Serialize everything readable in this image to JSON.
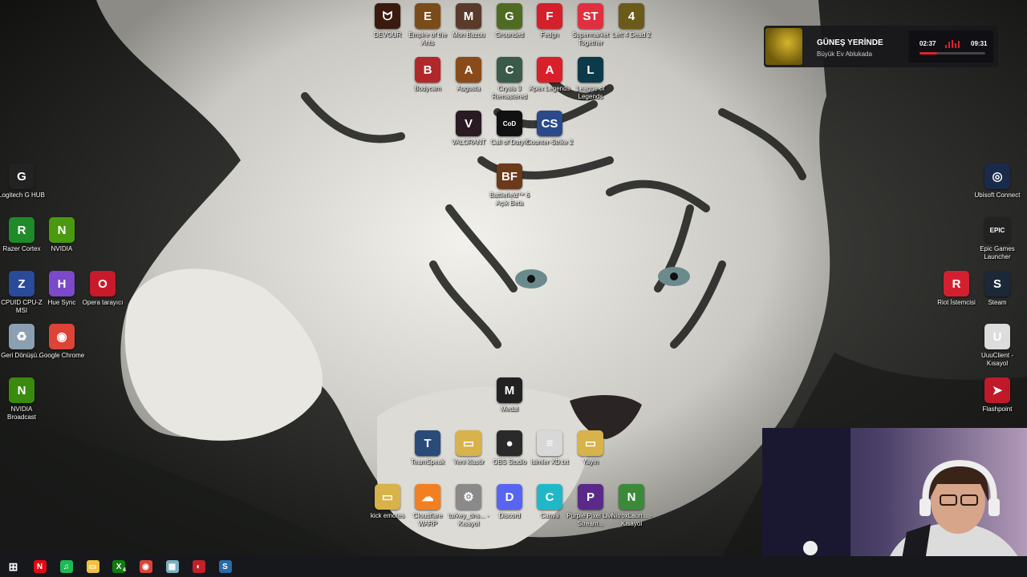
{
  "desktop_icons": [
    {
      "id": "devour",
      "label": "DEVOUR",
      "glyph": "ᗢ",
      "color": "#3a1a0e"
    },
    {
      "id": "empire-of-the-ants",
      "label": "Empire of the Ants",
      "glyph": "E",
      "color": "#7a4c1a"
    },
    {
      "id": "mon-bazou",
      "label": "Mon Bazou",
      "glyph": "M",
      "color": "#5a3a2a"
    },
    {
      "id": "grounded",
      "label": "Grounded",
      "glyph": "G",
      "color": "#4f6b21"
    },
    {
      "id": "fedgn",
      "label": "Fedgn",
      "glyph": "F",
      "color": "#d3202a"
    },
    {
      "id": "supermarket-together",
      "label": "Supermarket Together",
      "glyph": "ST",
      "color": "#e03040"
    },
    {
      "id": "left-4-dead-2",
      "label": "Left 4 Dead 2",
      "glyph": "4",
      "color": "#6b5a1a"
    },
    {
      "id": "bodycam",
      "label": "Bodycam",
      "glyph": "B",
      "color": "#b0282a"
    },
    {
      "id": "augusta",
      "label": "Augusta",
      "glyph": "A",
      "color": "#8a4a1a"
    },
    {
      "id": "crysis-3",
      "label": "Crysis 3 Remastered",
      "glyph": "C",
      "color": "#3a5a4a"
    },
    {
      "id": "apex-legends",
      "label": "Apex Legends",
      "glyph": "A",
      "color": "#d9202a"
    },
    {
      "id": "league-of-legends",
      "label": "League of Legends",
      "glyph": "L",
      "color": "#0c3a4a"
    },
    {
      "id": "valorant",
      "label": "VALORANT",
      "glyph": "V",
      "color": "#2a1a22"
    },
    {
      "id": "call-of-duty",
      "label": "Call of Duty®",
      "glyph": "CoD",
      "color": "#111111"
    },
    {
      "id": "counter-strike-2",
      "label": "Counter-Strike 2",
      "glyph": "CS",
      "color": "#2a4a8a"
    },
    {
      "id": "battlefield-6",
      "label": "Battlefield™ 6 Açık Beta",
      "glyph": "BF",
      "color": "#6a3a1a"
    },
    {
      "id": "logitech-g-hub",
      "label": "Logitech G HUB",
      "glyph": "G",
      "color": "#222222"
    },
    {
      "id": "razer-cortex",
      "label": "Razer Cortex",
      "glyph": "R",
      "color": "#1e8a2a"
    },
    {
      "id": "nvidia",
      "label": "NVIDIA",
      "glyph": "N",
      "color": "#4a9a10"
    },
    {
      "id": "cpuid",
      "label": "CPUID CPU-Z MSI",
      "glyph": "Z",
      "color": "#2a4a9a"
    },
    {
      "id": "hue-sync",
      "label": "Hue Sync",
      "glyph": "H",
      "color": "#7a4ac8"
    },
    {
      "id": "opera",
      "label": "Opera tarayıcı",
      "glyph": "O",
      "color": "#c81a2a"
    },
    {
      "id": "recycle-bin",
      "label": "Geri Dönüşü...",
      "glyph": "♻",
      "color": "#8aa0b0"
    },
    {
      "id": "google-chrome",
      "label": "Google Chrome",
      "glyph": "◉",
      "color": "#db4437"
    },
    {
      "id": "nvidia-broadcast",
      "label": "NVIDIA Broadcast",
      "glyph": "N",
      "color": "#3a8a10"
    },
    {
      "id": "medal",
      "label": "Medal",
      "glyph": "M",
      "color": "#222222"
    },
    {
      "id": "teamspeak",
      "label": "TeamSpeak",
      "glyph": "T",
      "color": "#2a4a7a"
    },
    {
      "id": "yeni-klasor",
      "label": "Yeni klasör",
      "glyph": "▭",
      "color": "#d8b24a"
    },
    {
      "id": "obs-studio",
      "label": "OBS Studio",
      "glyph": "●",
      "color": "#2a2a2a"
    },
    {
      "id": "isimler-txt",
      "label": "isimler XD.txt",
      "glyph": "≡",
      "color": "#d8d8d8"
    },
    {
      "id": "yayin",
      "label": "Yayın",
      "glyph": "▭",
      "color": "#d8b24a"
    },
    {
      "id": "kick-emotes",
      "label": "kick emotes",
      "glyph": "▭",
      "color": "#d8b24a"
    },
    {
      "id": "cloudflare-warp",
      "label": "Cloudflare WARP",
      "glyph": "☁",
      "color": "#f38020"
    },
    {
      "id": "turkey-dns",
      "label": "turkey_dns... - Kısayol",
      "glyph": "⚙",
      "color": "#8a8a8a"
    },
    {
      "id": "discord",
      "label": "Discord",
      "glyph": "D",
      "color": "#5865f2"
    },
    {
      "id": "canva",
      "label": "Canva",
      "glyph": "C",
      "color": "#20b8c8"
    },
    {
      "id": "purple-pixel",
      "label": "Purple Pixel Live Stream...",
      "glyph": "P",
      "color": "#5a2a8a"
    },
    {
      "id": "nitrox",
      "label": "NitroxLaun... - Kısayol",
      "glyph": "N",
      "color": "#3a8a3a"
    },
    {
      "id": "ubisoft-connect",
      "label": "Ubisoft Connect",
      "glyph": "◎",
      "color": "#1a2a4a"
    },
    {
      "id": "epic-games",
      "label": "Epic Games Launcher",
      "glyph": "EPIC",
      "color": "#222222"
    },
    {
      "id": "riot-client",
      "label": "Riot İstemcisi",
      "glyph": "R",
      "color": "#d32030"
    },
    {
      "id": "steam",
      "label": "Steam",
      "glyph": "S",
      "color": "#1b2838"
    },
    {
      "id": "uuuclient",
      "label": "UuuClient - Kısayol",
      "glyph": "U",
      "color": "#dddddd"
    },
    {
      "id": "flashpoint",
      "label": "Flashpoint",
      "glyph": "➤",
      "color": "#c01a2a"
    }
  ],
  "music_widget": {
    "title": "GÜNEŞ YERİNDE",
    "subtitle": "Büyük Ev Ablukada",
    "time_current": "02:37",
    "time_total": "09:31",
    "progress": 0.27,
    "accent": "#e0202a"
  },
  "taskbar": {
    "items": [
      {
        "id": "start",
        "glyph": "⊞",
        "color": "#ffffff"
      },
      {
        "id": "netflix",
        "glyph": "N",
        "color": "#e50914"
      },
      {
        "id": "spotify",
        "glyph": "♫",
        "color": "#1db954"
      },
      {
        "id": "file-explorer",
        "glyph": "▭",
        "color": "#f0c040"
      },
      {
        "id": "xbox",
        "glyph": "X",
        "color": "#107c10"
      },
      {
        "id": "chrome",
        "glyph": "◉",
        "color": "#db4437"
      },
      {
        "id": "app-6",
        "glyph": "▦",
        "color": "#7ab0c0"
      },
      {
        "id": "app-7",
        "glyph": "◐",
        "color": "#c0202a"
      },
      {
        "id": "steam",
        "glyph": "S",
        "color": "#2a6aa8"
      }
    ],
    "xbox_badge": "4"
  }
}
